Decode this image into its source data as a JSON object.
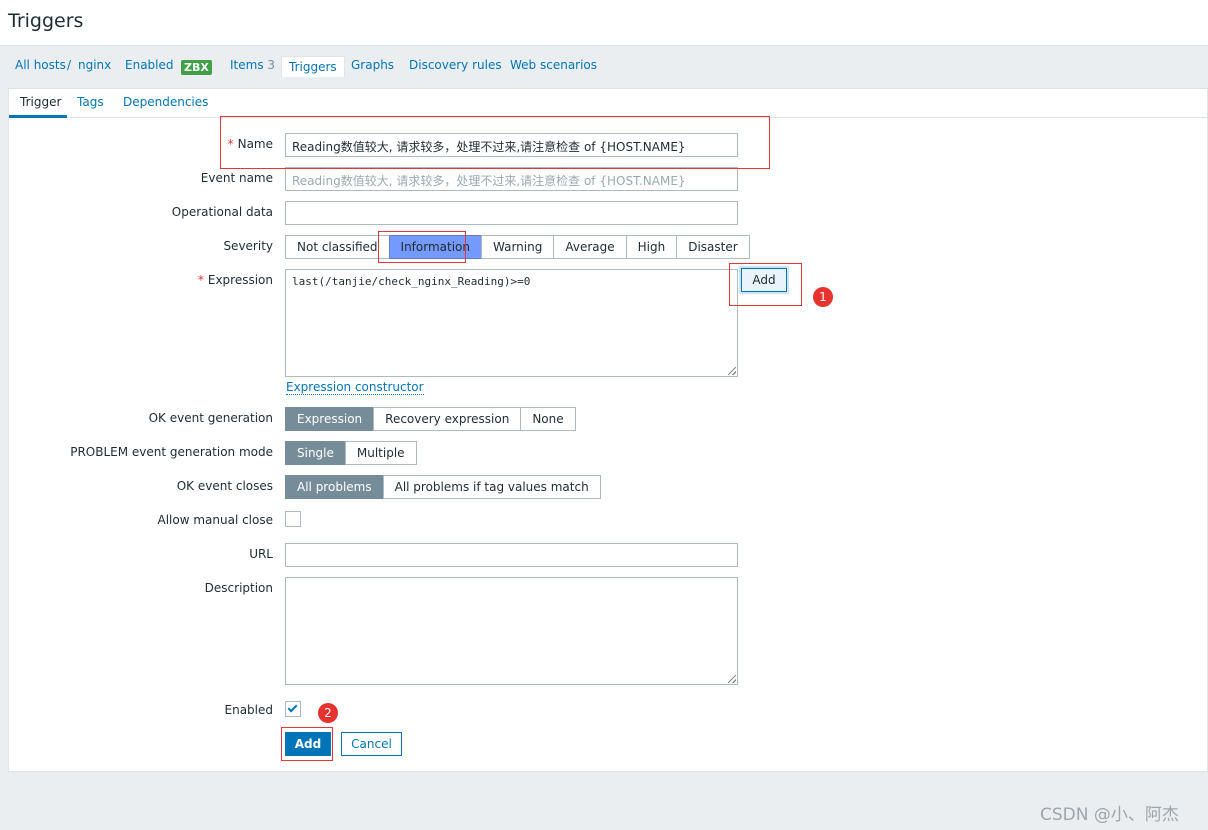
{
  "page": {
    "title": "Triggers"
  },
  "nav": {
    "all_hosts": "All hosts",
    "separator": "/",
    "host": "nginx",
    "enabled": "Enabled",
    "zbx_badge": "ZBX",
    "items_label": "Items",
    "items_count": "3",
    "triggers": "Triggers",
    "graphs": "Graphs",
    "discovery_rules": "Discovery rules",
    "web_scenarios": "Web scenarios"
  },
  "tabs": {
    "trigger": "Trigger",
    "tags": "Tags",
    "dependencies": "Dependencies"
  },
  "form": {
    "name_label": "Name",
    "name_value": "Reading数值较大, 请求较多，处理不过来,请注意检查 of {HOST.NAME}",
    "event_name_label": "Event name",
    "event_name_placeholder": "Reading数值较大, 请求较多，处理不过来,请注意检查 of {HOST.NAME}",
    "operational_data_label": "Operational data",
    "severity_label": "Severity",
    "severity_options": [
      "Not classified",
      "Information",
      "Warning",
      "Average",
      "High",
      "Disaster"
    ],
    "severity_selected": "Information",
    "expression_label": "Expression",
    "expression_value": "last(/tanjie/check_nginx_Reading)>=0",
    "expression_add_button": "Add",
    "expression_constructor_link": "Expression constructor",
    "ok_event_generation_label": "OK event generation",
    "ok_event_generation_options": [
      "Expression",
      "Recovery expression",
      "None"
    ],
    "ok_event_generation_selected": "Expression",
    "problem_mode_label": "PROBLEM event generation mode",
    "problem_mode_options": [
      "Single",
      "Multiple"
    ],
    "problem_mode_selected": "Single",
    "ok_event_closes_label": "OK event closes",
    "ok_event_closes_options": [
      "All problems",
      "All problems if tag values match"
    ],
    "ok_event_closes_selected": "All problems",
    "allow_manual_close_label": "Allow manual close",
    "allow_manual_close_checked": false,
    "url_label": "URL",
    "url_value": "",
    "description_label": "Description",
    "description_value": "",
    "enabled_label": "Enabled",
    "enabled_checked": true,
    "add_button": "Add",
    "cancel_button": "Cancel"
  },
  "annotations": {
    "badge_1": "1",
    "badge_2": "2"
  },
  "watermark": "CSDN @小、阿杰",
  "colors": {
    "link": "#0275b8",
    "selected_segment": "#768d99",
    "information_severity": "#7499ff",
    "enabled_green": "#429e47",
    "annotation_red": "#e3363a"
  }
}
